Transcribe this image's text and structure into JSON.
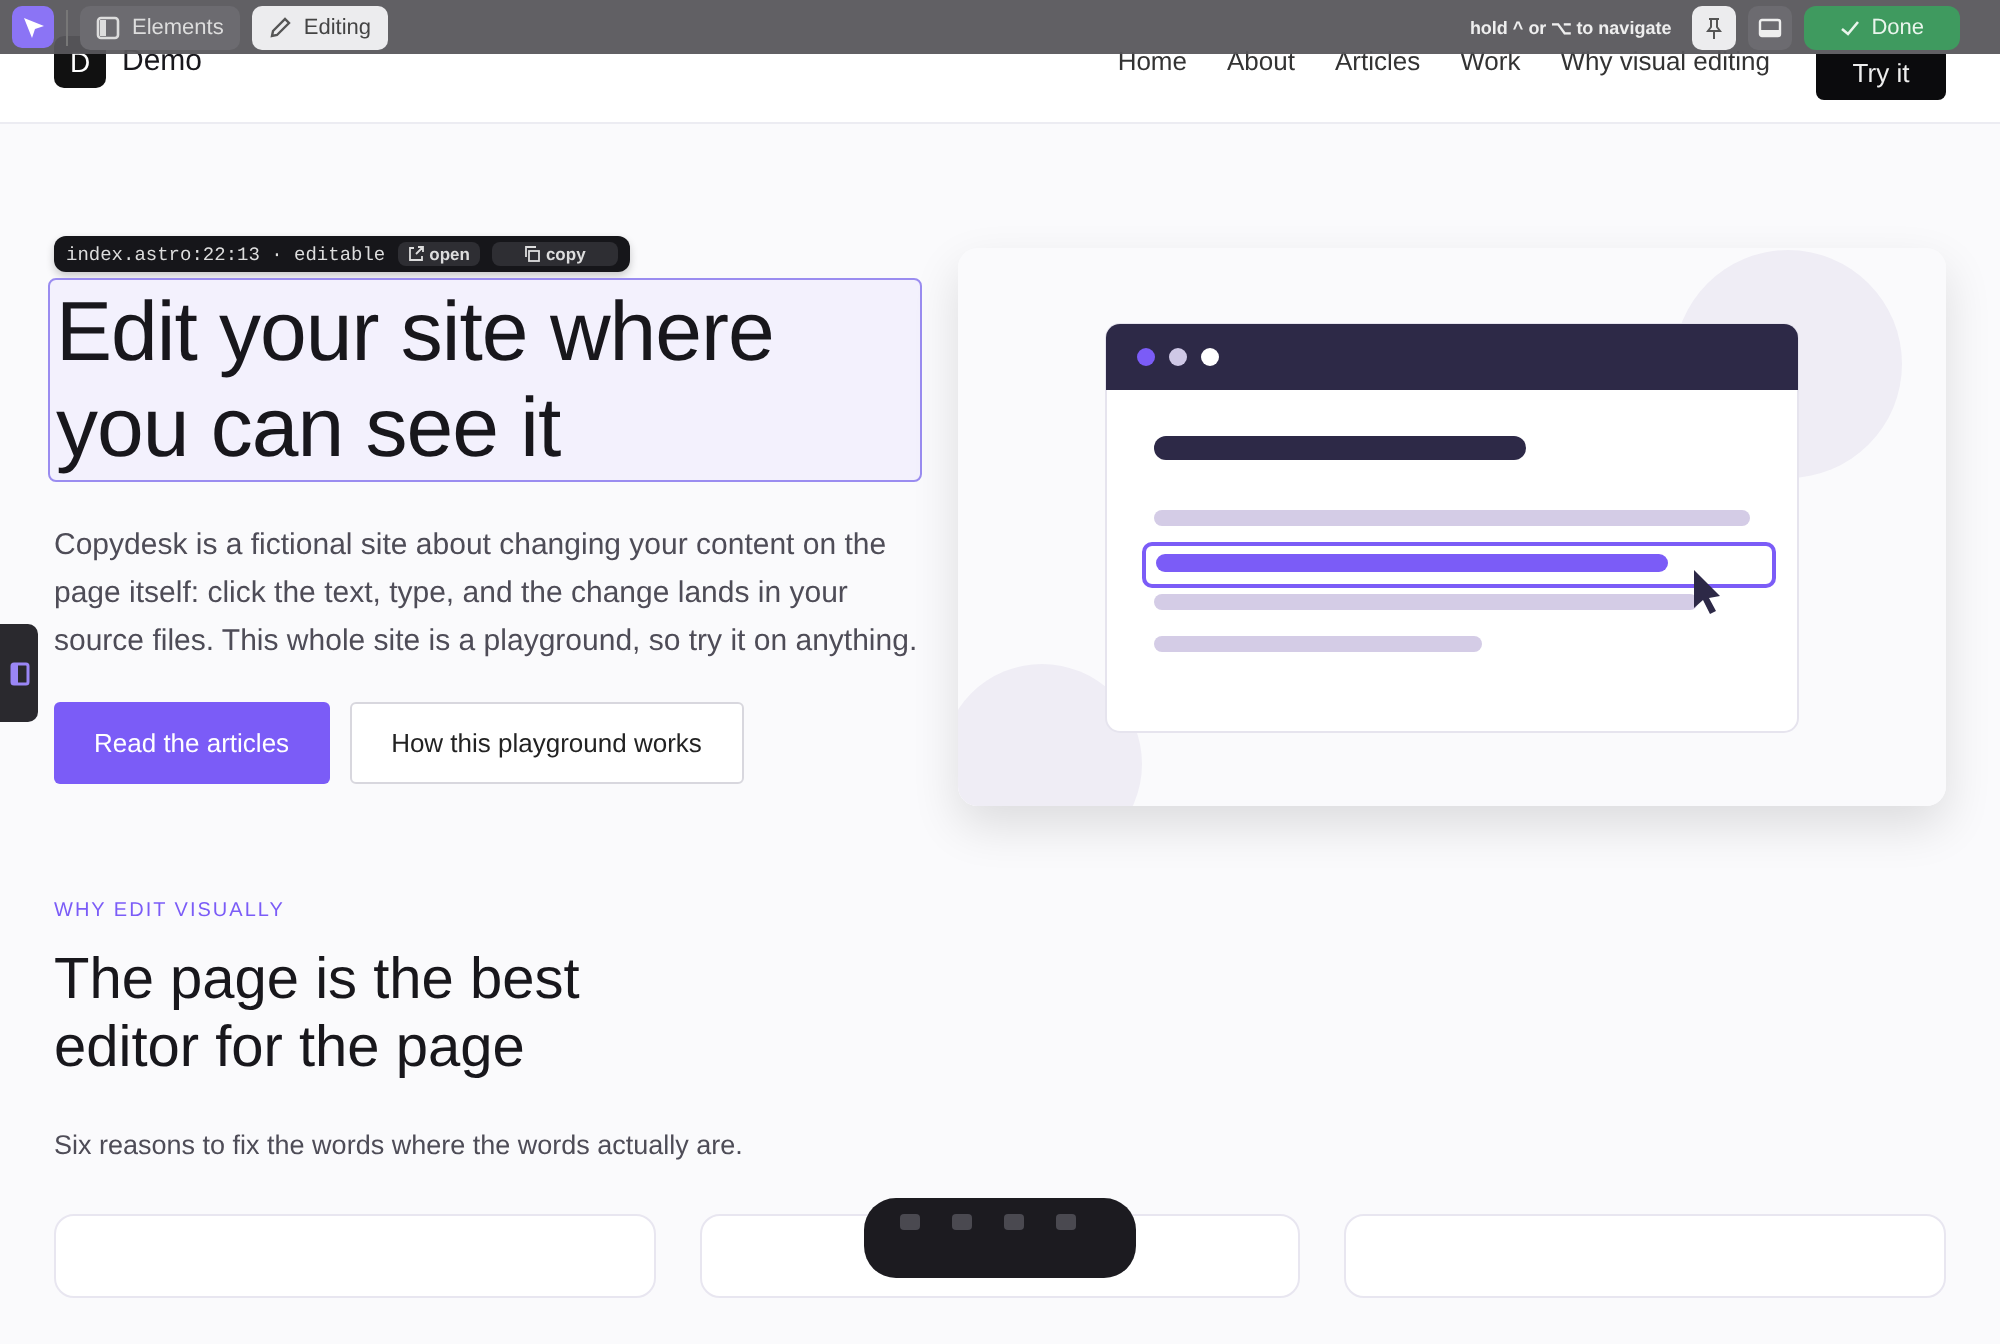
{
  "editor_toolbar": {
    "select_tool": {
      "active": true
    },
    "modes": [
      {
        "label": "Elements",
        "selected": false
      },
      {
        "label": "Editing",
        "selected": true
      }
    ],
    "hint": "hold ^ or ⌥ to navigate",
    "pin": {
      "on": true
    },
    "done": "Done"
  },
  "site_header": {
    "logo_letter": "D",
    "site_name": "Demo",
    "nav": [
      "Home",
      "About",
      "Articles",
      "Work",
      "Why visual editing"
    ],
    "cta": "Try it"
  },
  "hero": {
    "source_tag": {
      "location": "index.astro:22:13 · editable",
      "open": "open",
      "copy": "copy"
    },
    "title": "Edit your site where you can see it",
    "title_selected": true,
    "body": "Copydesk is a fictional site about changing your content on the page itself: click the text, type, and the change lands in your source files. This whole site is a playground, so try it on anything.",
    "buttons": [
      {
        "label": "Read the articles",
        "kind": "primary"
      },
      {
        "label": "How this playground works",
        "kind": "secondary"
      }
    ]
  },
  "reasons": {
    "eyebrow": "WHY EDIT VISUALLY",
    "title": "The page is the best editor for the page",
    "subtitle": "Six reasons to fix the words where the words actually are."
  }
}
